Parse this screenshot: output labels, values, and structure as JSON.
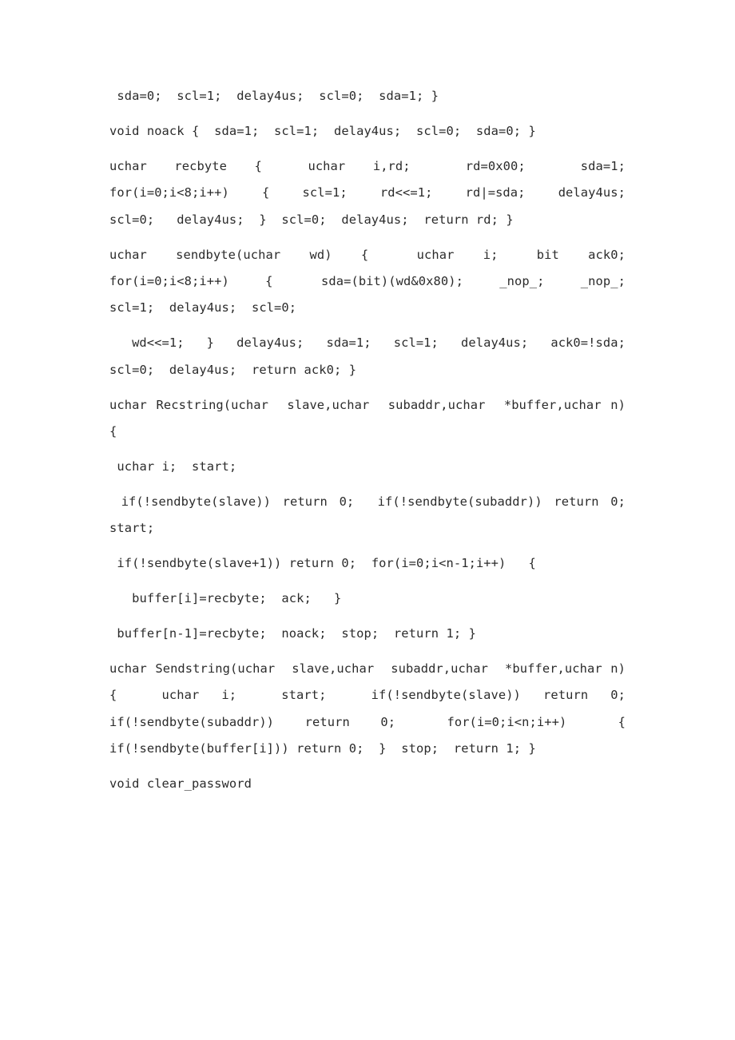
{
  "document": {
    "page_background": "#ffffff",
    "text_color": "#2b2b2b",
    "language": "c",
    "paragraphs": [
      {
        "id": "p1-stop-tail",
        "text": " sda=0;  scl=1;  delay4us;  scl=0;  sda=1; }"
      },
      {
        "id": "p2-noack",
        "text": "void noack {  sda=1;  scl=1;  delay4us;  scl=0;  sda=0; }"
      },
      {
        "id": "p3-recbyte",
        "text": "uchar   recbyte   {     uchar   i,rd;      rd=0x00;      sda=1;  for(i=0;i<8;i++)   {   scl=1;   rd<<=1;   rd|=sda;   delay4us;  scl=0;   delay4us;  }  scl=0;  delay4us;  return rd; }"
      },
      {
        "id": "p4-sendbyte-head",
        "text": "uchar   sendbyte(uchar   wd)   {     uchar   i;    bit   ack0;  for(i=0;i<8;i++)   {    sda=(bit)(wd&0x80);   _nop_;   _nop_;  scl=1;  delay4us;  scl=0;"
      },
      {
        "id": "p5-sendbyte-tail",
        "text": "  wd<<=1;  }  delay4us;  sda=1;  scl=1;  delay4us;  ack0=!sda;  scl=0;  delay4us;  return ack0; }"
      },
      {
        "id": "p6-recstring-sig",
        "text": "uchar Recstring(uchar  slave,uchar  subaddr,uchar  *buffer,uchar n) {"
      },
      {
        "id": "p7-recstring-decl",
        "text": " uchar i;  start;"
      },
      {
        "id": "p8-recstring-sendbyte",
        "text": " if(!sendbyte(slave)) return 0;  if(!sendbyte(subaddr)) return 0;  start;"
      },
      {
        "id": "p9-recstring-loop",
        "text": " if(!sendbyte(slave+1)) return 0;  for(i=0;i<n-1;i++)   {"
      },
      {
        "id": "p10-recstring-body",
        "text": "   buffer[i]=recbyte;  ack;   }"
      },
      {
        "id": "p11-recstring-end",
        "text": " buffer[n-1]=recbyte;  noack;  stop;  return 1; }"
      },
      {
        "id": "p12-sendstring",
        "text": "uchar Sendstring(uchar  slave,uchar  subaddr,uchar  *buffer,uchar n)  {    uchar  i;    start;    if(!sendbyte(slave))  return  0;  if(!sendbyte(subaddr))   return   0;     for(i=0;i<n;i++)     {  if(!sendbyte(buffer[i])) return 0;  }  stop;  return 1; }"
      },
      {
        "id": "p13-clear-password",
        "text": "void clear_password"
      }
    ]
  }
}
